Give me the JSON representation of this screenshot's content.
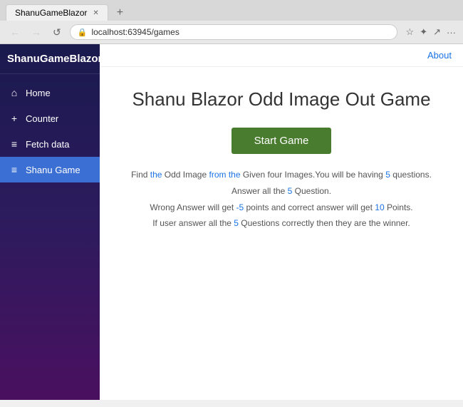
{
  "browser": {
    "tab_title": "ShanuGameBlazor",
    "url": "localhost:63945/games",
    "nav": {
      "back": "←",
      "forward": "→",
      "refresh": "↺",
      "home": "⌂"
    },
    "about_link": "About"
  },
  "sidebar": {
    "title": "ShanuGameBlazor",
    "items": [
      {
        "id": "home",
        "label": "Home",
        "icon": "⌂",
        "active": false
      },
      {
        "id": "counter",
        "label": "Counter",
        "icon": "+",
        "active": false
      },
      {
        "id": "fetch-data",
        "label": "Fetch data",
        "icon": "≡",
        "active": false
      },
      {
        "id": "shanu-game",
        "label": "Shanu Game",
        "icon": "≡",
        "active": true
      }
    ]
  },
  "main": {
    "heading": "Shanu Blazor Odd Image Out Game",
    "start_button": "Start Game",
    "description_lines": [
      "Find the Odd Image from the Given four Images.You will be having 5 questions.",
      "Answer all the 5 Question.",
      "Wrong Answer will get -5 points and correct answer will get 10 Points.",
      "If user answer all the 5 Questions correctly then they are the winner."
    ]
  }
}
